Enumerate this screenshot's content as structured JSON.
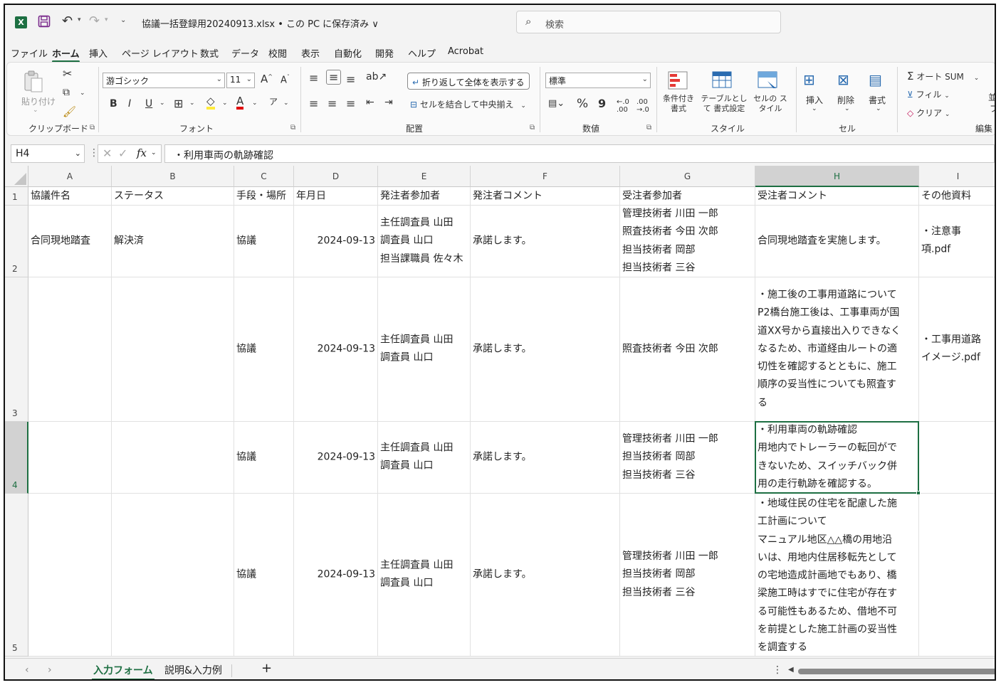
{
  "titlebar": {
    "app_icon": "excel-logo-icon",
    "file_title": "協議一括登録用20240913.xlsx • この PC に保存済み ∨",
    "search_placeholder": "検索"
  },
  "menu": {
    "tabs": [
      "ファイル",
      "ホーム",
      "挿入",
      "ページ レイアウト",
      "数式",
      "データ",
      "校閲",
      "表示",
      "自動化",
      "開発",
      "ヘルプ",
      "Acrobat"
    ],
    "active": "ホーム"
  },
  "ribbon": {
    "clipboard": {
      "label": "クリップボード",
      "paste": "貼り付け"
    },
    "font": {
      "label": "フォント",
      "font_name": "游ゴシック",
      "font_size": "11"
    },
    "alignment": {
      "label": "配置",
      "wrap_text": "折り返して全体を表示する",
      "merge_center": "セルを結合して中央揃え"
    },
    "number": {
      "label": "数値",
      "format": "標準",
      "percent": "%",
      "comma": "9"
    },
    "styles": {
      "label": "スタイル",
      "conditional": "条件付き 書式",
      "table": "テーブルとして 書式設定",
      "cell_styles": "セルの スタイル"
    },
    "cells": {
      "label": "セル",
      "insert": "挿入",
      "delete": "削除",
      "format": "書式"
    },
    "editing": {
      "label": "編集",
      "autosum": "オート SUM",
      "fill": "フィル",
      "clear": "クリア",
      "sort": "並",
      "find": "フ"
    }
  },
  "formula_bar": {
    "cell_ref": "H4",
    "fx": "fx",
    "formula": "・利用車両の軌跡確認"
  },
  "sheet": {
    "columns": [
      "A",
      "B",
      "C",
      "D",
      "E",
      "F",
      "G",
      "H",
      "I"
    ],
    "selected_col": "H",
    "selected_row": "4",
    "rows": [
      {
        "num": "1",
        "cells": [
          "協議件名",
          "ステータス",
          "手段・場所",
          "年月日",
          "発注者参加者",
          "発注者コメント",
          "受注者参加者",
          "受注者コメント",
          "その他資料"
        ]
      },
      {
        "num": "2",
        "cells": [
          "合同現地踏査",
          "解決済",
          "協議",
          "2024-09-13",
          "主任調査員 山田\n調査員 山口\n担当課職員 佐々木",
          "承諾します。",
          "管理技術者 川田 一郎\n照査技術者 今田 次郎\n担当技術者 岡部\n担当技術者 三谷",
          "合同現地踏査を実施します。",
          "・注意事\n項.pdf"
        ]
      },
      {
        "num": "3",
        "cells": [
          "",
          "",
          "協議",
          "2024-09-13",
          "主任調査員 山田\n調査員 山口",
          "承諾します。",
          "照査技術者 今田 次郎",
          "・施工後の工事用道路について\nP2橋台施工後は、工事車両が国\n道XX号から直接出入りできなく\nなるため、市道経由ルートの適\n切性を確認するとともに、施工\n順序の妥当性についても照査す\nる",
          "・工事用道路\nイメージ.pdf"
        ]
      },
      {
        "num": "4",
        "cells": [
          "",
          "",
          "協議",
          "2024-09-13",
          "主任調査員 山田\n調査員 山口",
          "承諾します。",
          "管理技術者 川田 一郎\n担当技術者 岡部\n担当技術者 三谷",
          "・利用車両の軌跡確認\n用地内でトレーラーの転回がで\nきないため、スイッチバック併\n用の走行軌跡を確認する。",
          ""
        ]
      },
      {
        "num": "5",
        "cells": [
          "",
          "",
          "協議",
          "2024-09-13",
          "主任調査員 山田\n調査員 山口",
          "承諾します。",
          "管理技術者 川田 一郎\n担当技術者 岡部\n担当技術者 三谷",
          "・地域住民の住宅を配慮した施\n工計画について\nマニュアル地区△△橋の用地沿\nいは、用地内住居移転先として\nの宅地造成計画地でもあり、橋\n梁施工時はすでに住宅が存在す\nる可能性もあるため、借地不可\nを前提とした施工計画の妥当性\nを調査する",
          ""
        ]
      }
    ]
  },
  "sheet_tabs": {
    "tabs": [
      "入力フォーム",
      "説明&入力例"
    ],
    "active": "入力フォーム",
    "add": "+"
  },
  "colors": {
    "accent": "#1d6f42",
    "grid_line": "#e1e1e1"
  }
}
